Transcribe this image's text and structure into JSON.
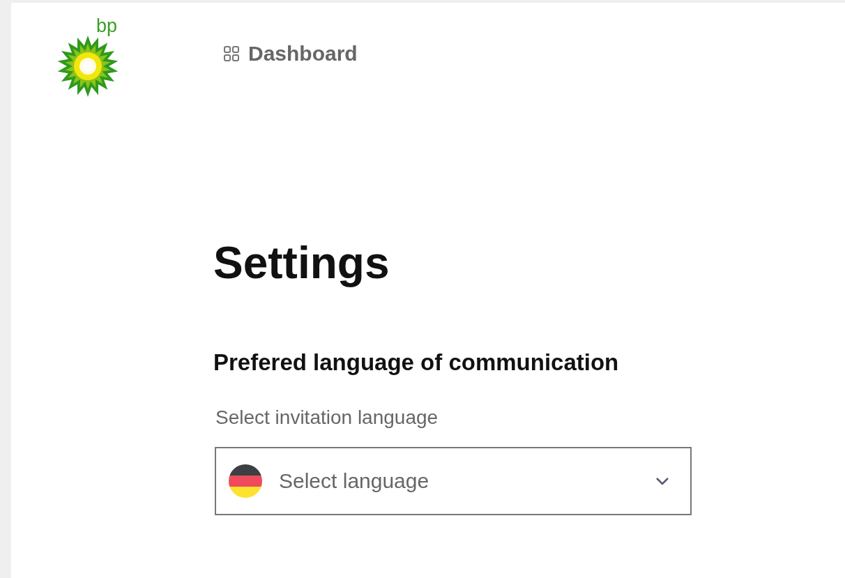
{
  "logo": {
    "text": "bp"
  },
  "nav": [
    {
      "label": "Dashboard"
    }
  ],
  "title": "Settings",
  "section": {
    "heading": "Prefered language of communication",
    "field_label": "Select invitation language",
    "select": {
      "placeholder": "Select language"
    }
  }
}
